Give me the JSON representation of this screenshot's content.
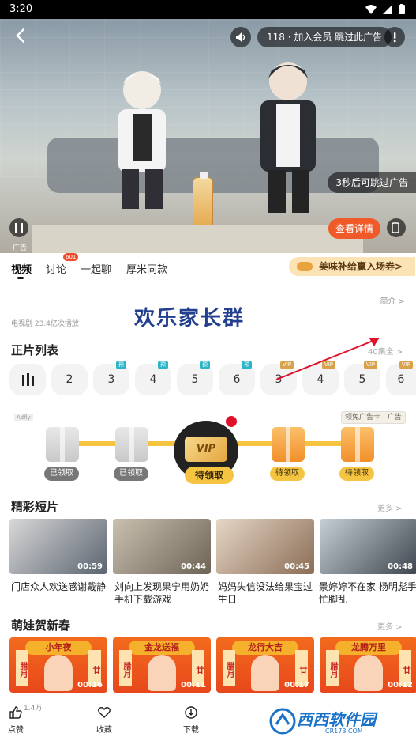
{
  "status_bar": {
    "time": "3:20"
  },
  "player": {
    "skip_text": "118 · 加入会员 跳过此广告",
    "countdown_text": "3秒后可跳过广告",
    "details_button": "查看详情",
    "ad_label": "广告"
  },
  "tabs": {
    "items": [
      {
        "label": "视频"
      },
      {
        "label": "讨论"
      },
      {
        "label": "一起聊"
      },
      {
        "label": "厚米同款"
      }
    ],
    "discussion_badge": "601",
    "promo": "美味补给赢入场券>"
  },
  "banner": {
    "title": "欢乐家长群",
    "meta": "电视剧   23.4亿次播放",
    "summary": "简介 >"
  },
  "episode_list": {
    "title": "正片列表",
    "more": "40集全 >",
    "episodes": [
      {
        "label": "",
        "tag": ""
      },
      {
        "label": "2",
        "tag": ""
      },
      {
        "label": "3",
        "tag": "预"
      },
      {
        "label": "4",
        "tag": "预"
      },
      {
        "label": "5",
        "tag": "预"
      },
      {
        "label": "6",
        "tag": "预"
      },
      {
        "label": "3",
        "tag": "VIP"
      },
      {
        "label": "4",
        "tag": "VIP"
      },
      {
        "label": "5",
        "tag": "VIP"
      },
      {
        "label": "6",
        "tag": "VIP"
      }
    ]
  },
  "rewards": {
    "adfly": "Adfly",
    "corner": "领免广告卡 | 广告",
    "items": [
      {
        "label": "已领取"
      },
      {
        "label": "已领取"
      },
      {
        "label": "待领取"
      },
      {
        "label": "待领取"
      },
      {
        "label": "待领取"
      }
    ],
    "vip_text": "VIP"
  },
  "shorts": {
    "title": "精彩短片",
    "more": "更多 >",
    "items": [
      {
        "duration": "00:59",
        "caption": "门店众人欢送感谢戴静"
      },
      {
        "duration": "00:44",
        "caption": "刘向上发现果宁用奶奶手机下载游戏"
      },
      {
        "duration": "00:45",
        "caption": "妈妈失信没法给果宝过生日"
      },
      {
        "duration": "00:48",
        "caption": "景婷婷不在家 杨明彪手忙脚乱"
      }
    ]
  },
  "spring": {
    "title": "萌娃贺新春",
    "more": "更多 >",
    "items": [
      {
        "duration": "00:16",
        "top": "小年夜",
        "left": "腊月",
        "right": "廿"
      },
      {
        "duration": "00:11",
        "top": "金龙送福",
        "left": "腊月",
        "right": "廿"
      },
      {
        "duration": "00:17",
        "top": "龙行大吉",
        "left": "腊月",
        "right": "廿"
      },
      {
        "duration": "00:12",
        "top": "龙腾万里",
        "left": "腊月",
        "right": "廿"
      }
    ]
  },
  "bottom_bar": {
    "like_count": "1.4万",
    "like": "点赞",
    "favorite": "收藏",
    "download": "下载",
    "watermark": "西西软件园",
    "watermark_sub": "CR173.COM"
  }
}
